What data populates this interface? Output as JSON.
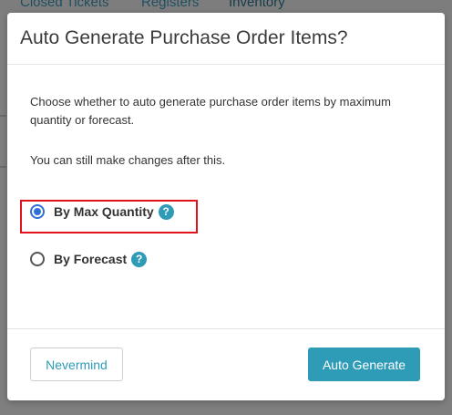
{
  "background": {
    "tabs": [
      "Closed Tickets",
      "Registers",
      "Inventory"
    ]
  },
  "modal": {
    "title": "Auto Generate Purchase Order Items?",
    "description": "Choose whether to auto generate purchase order items by maximum quantity or forecast.",
    "note": "You can still make changes after this.",
    "options": [
      {
        "label": "By Max Quantity",
        "selected": true,
        "help_icon": "?"
      },
      {
        "label": "By Forecast",
        "selected": false,
        "help_icon": "?"
      }
    ],
    "buttons": {
      "nevermind": "Nevermind",
      "generate": "Auto Generate"
    }
  },
  "colors": {
    "accent": "#2e9bb7",
    "radio_selected": "#2f6fd6",
    "highlight": "#e0121b"
  }
}
